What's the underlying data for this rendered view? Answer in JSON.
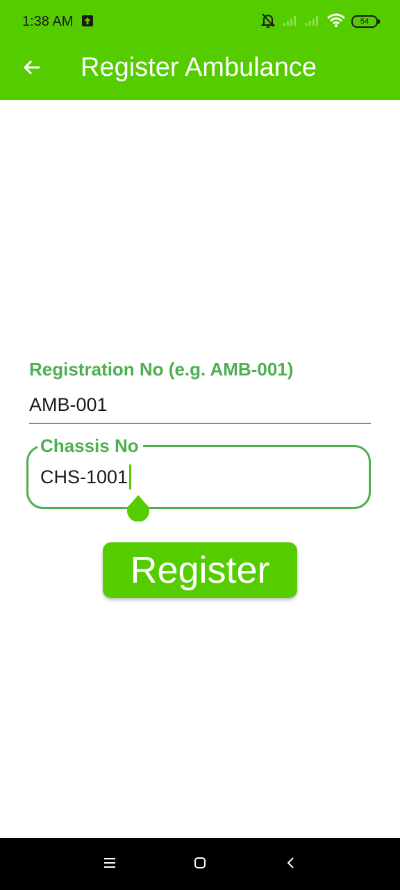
{
  "status_bar": {
    "time": "1:38 AM",
    "battery": "54",
    "icons": [
      "upload-icon",
      "silent-bell-icon",
      "signal-icon",
      "signal-icon",
      "wifi-icon",
      "battery-icon"
    ]
  },
  "app_bar": {
    "title": "Register Ambulance",
    "back_icon": "arrow-left-icon"
  },
  "form": {
    "registration": {
      "label": "Registration No (e.g. AMB-001)",
      "value": "AMB-001"
    },
    "chassis": {
      "label": "Chassis No",
      "value": "CHS-1001"
    },
    "register_label": "Register"
  },
  "nav_bar": {
    "icons": [
      "menu-icon",
      "home-icon",
      "back-icon"
    ]
  },
  "colors": {
    "primary": "#55cc00",
    "label_green": "#4caf50",
    "text": "#1a1a1a"
  }
}
